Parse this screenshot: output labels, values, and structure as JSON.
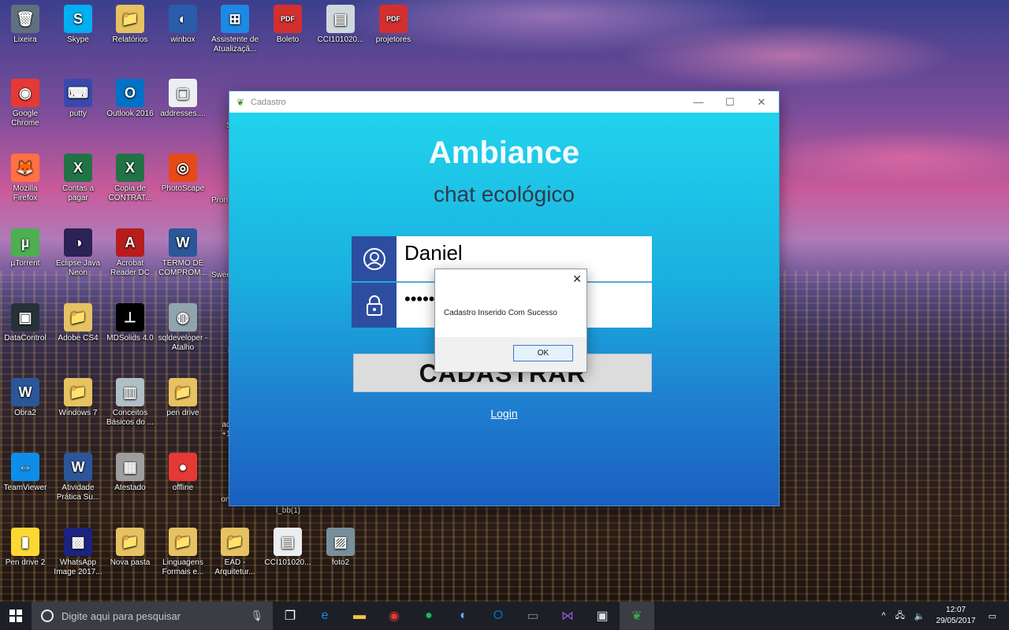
{
  "desktop": {
    "icons": [
      {
        "label": "Lixeira",
        "glyph": "🗑",
        "color": "#607080"
      },
      {
        "label": "Skype",
        "glyph": "S",
        "color": "#00aff0"
      },
      {
        "label": "Relatórios",
        "glyph": "📁",
        "color": "#e6c262"
      },
      {
        "label": "winbox",
        "glyph": "◐",
        "color": "#2a5caa"
      },
      {
        "label": "Assistente de Atualizaçã...",
        "glyph": "⊞",
        "color": "#1e88e5"
      },
      {
        "label": "Boleto",
        "glyph": "PDF",
        "color": "#d32f2f"
      },
      {
        "label": "CCI101020...",
        "glyph": "▤",
        "color": "#cfd8dc"
      },
      {
        "label": "projetores",
        "glyph": "PDF",
        "color": "#d32f2f"
      },
      {
        "label": "Google Chrome",
        "glyph": "◉",
        "color": "#e53935"
      },
      {
        "label": "putty",
        "glyph": "⌨",
        "color": "#3949ab"
      },
      {
        "label": "Outlook 2016",
        "glyph": "O",
        "color": "#0072c6"
      },
      {
        "label": "addresses....",
        "glyph": "▢",
        "color": "#eceff1"
      },
      {
        "label": "Mozilla Firefox",
        "glyph": "🦊",
        "color": "#ff7043"
      },
      {
        "label": "Contas a pagar",
        "glyph": "X",
        "color": "#217346"
      },
      {
        "label": "Copia de CONTRAT...",
        "glyph": "X",
        "color": "#217346"
      },
      {
        "label": "PhotoScape",
        "glyph": "◎",
        "color": "#e64a19"
      },
      {
        "label": "µTorrent",
        "glyph": "µ",
        "color": "#4caf50"
      },
      {
        "label": "Eclipse Java Neon",
        "glyph": "◑",
        "color": "#2c2255"
      },
      {
        "label": "Acrobat Reader DC",
        "glyph": "A",
        "color": "#b71c1c"
      },
      {
        "label": "TERMO DE COMPROM...",
        "glyph": "W",
        "color": "#2b579a"
      },
      {
        "label": "DataControl",
        "glyph": "▣",
        "color": "#263238"
      },
      {
        "label": "Adobe CS4",
        "glyph": "📁",
        "color": "#e6c262"
      },
      {
        "label": "MDSolids 4.0",
        "glyph": "⊥",
        "color": "#000000"
      },
      {
        "label": "sqldeveloper - Atalho",
        "glyph": "◍",
        "color": "#90a4ae"
      },
      {
        "label": "Obra2",
        "glyph": "W",
        "color": "#2b579a"
      },
      {
        "label": "Windows 7",
        "glyph": "📁",
        "color": "#e6c262"
      },
      {
        "label": "Conceitos Básicos do ...",
        "glyph": "▥",
        "color": "#b0bec5"
      },
      {
        "label": "pen drive",
        "glyph": "📁",
        "color": "#e6c262"
      },
      {
        "label": "TeamViewer",
        "glyph": "⇔",
        "color": "#0e8ee9"
      },
      {
        "label": "Atividade Prática Su...",
        "glyph": "W",
        "color": "#2b579a"
      },
      {
        "label": "Atestado",
        "glyph": "▦",
        "color": "#9e9e9e"
      },
      {
        "label": "offline",
        "glyph": "●",
        "color": "#e53935"
      },
      {
        "label": "Pen drive 2",
        "glyph": "▮",
        "color": "#fdd835"
      },
      {
        "label": "WhatsApp Image 2017...",
        "glyph": "▩",
        "color": "#1a237e"
      },
      {
        "label": "Nova pasta",
        "glyph": "📁",
        "color": "#e6c262"
      },
      {
        "label": "Linguagens Formais e...",
        "glyph": "📁",
        "color": "#e6c262"
      },
      {
        "label": "EAD - Arquitetur...",
        "glyph": "📁",
        "color": "#e6c262"
      },
      {
        "label": "CCI101020...",
        "glyph": "▤",
        "color": "#eceff1"
      },
      {
        "label": "foto2",
        "glyph": "▨",
        "color": "#78909c"
      }
    ],
    "partial_labels": [
      "Sp",
      "Pron",
      "Swee",
      "M",
      "ad +1",
      "onl",
      "l_bb(1)"
    ]
  },
  "window": {
    "title": "Cadastro",
    "minimize": "—",
    "maximize": "☐",
    "close": "✕",
    "brand": "Ambiance",
    "tagline": "chat ecológico",
    "username_value": "Daniel",
    "password_value": "•••••",
    "submit_label": "CADASTRAR",
    "login_link": "Login"
  },
  "dialog": {
    "message": "Cadastro Inserido Com Sucesso",
    "ok_label": "OK",
    "close": "✕"
  },
  "taskbar": {
    "search_placeholder": "Digite aqui para pesquisar",
    "time": "12:07",
    "date": "29/05/2017"
  }
}
